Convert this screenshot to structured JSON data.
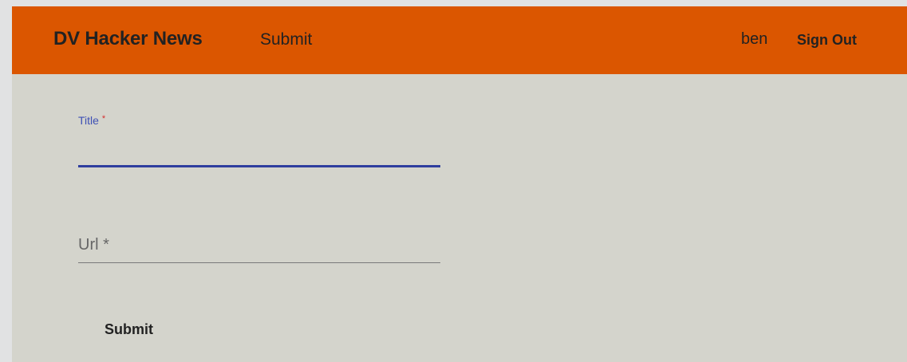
{
  "header": {
    "brand": "DV Hacker News",
    "nav_submit": "Submit",
    "username": "ben",
    "sign_out": "Sign Out"
  },
  "form": {
    "title_label": "Title",
    "title_required_mark": "*",
    "title_value": "",
    "url_label": "Url *",
    "url_value": "",
    "submit_label": "Submit"
  },
  "colors": {
    "header_bg": "#db5600",
    "page_bg": "#d4d4cc",
    "focus_accent": "#2f3e9e"
  }
}
